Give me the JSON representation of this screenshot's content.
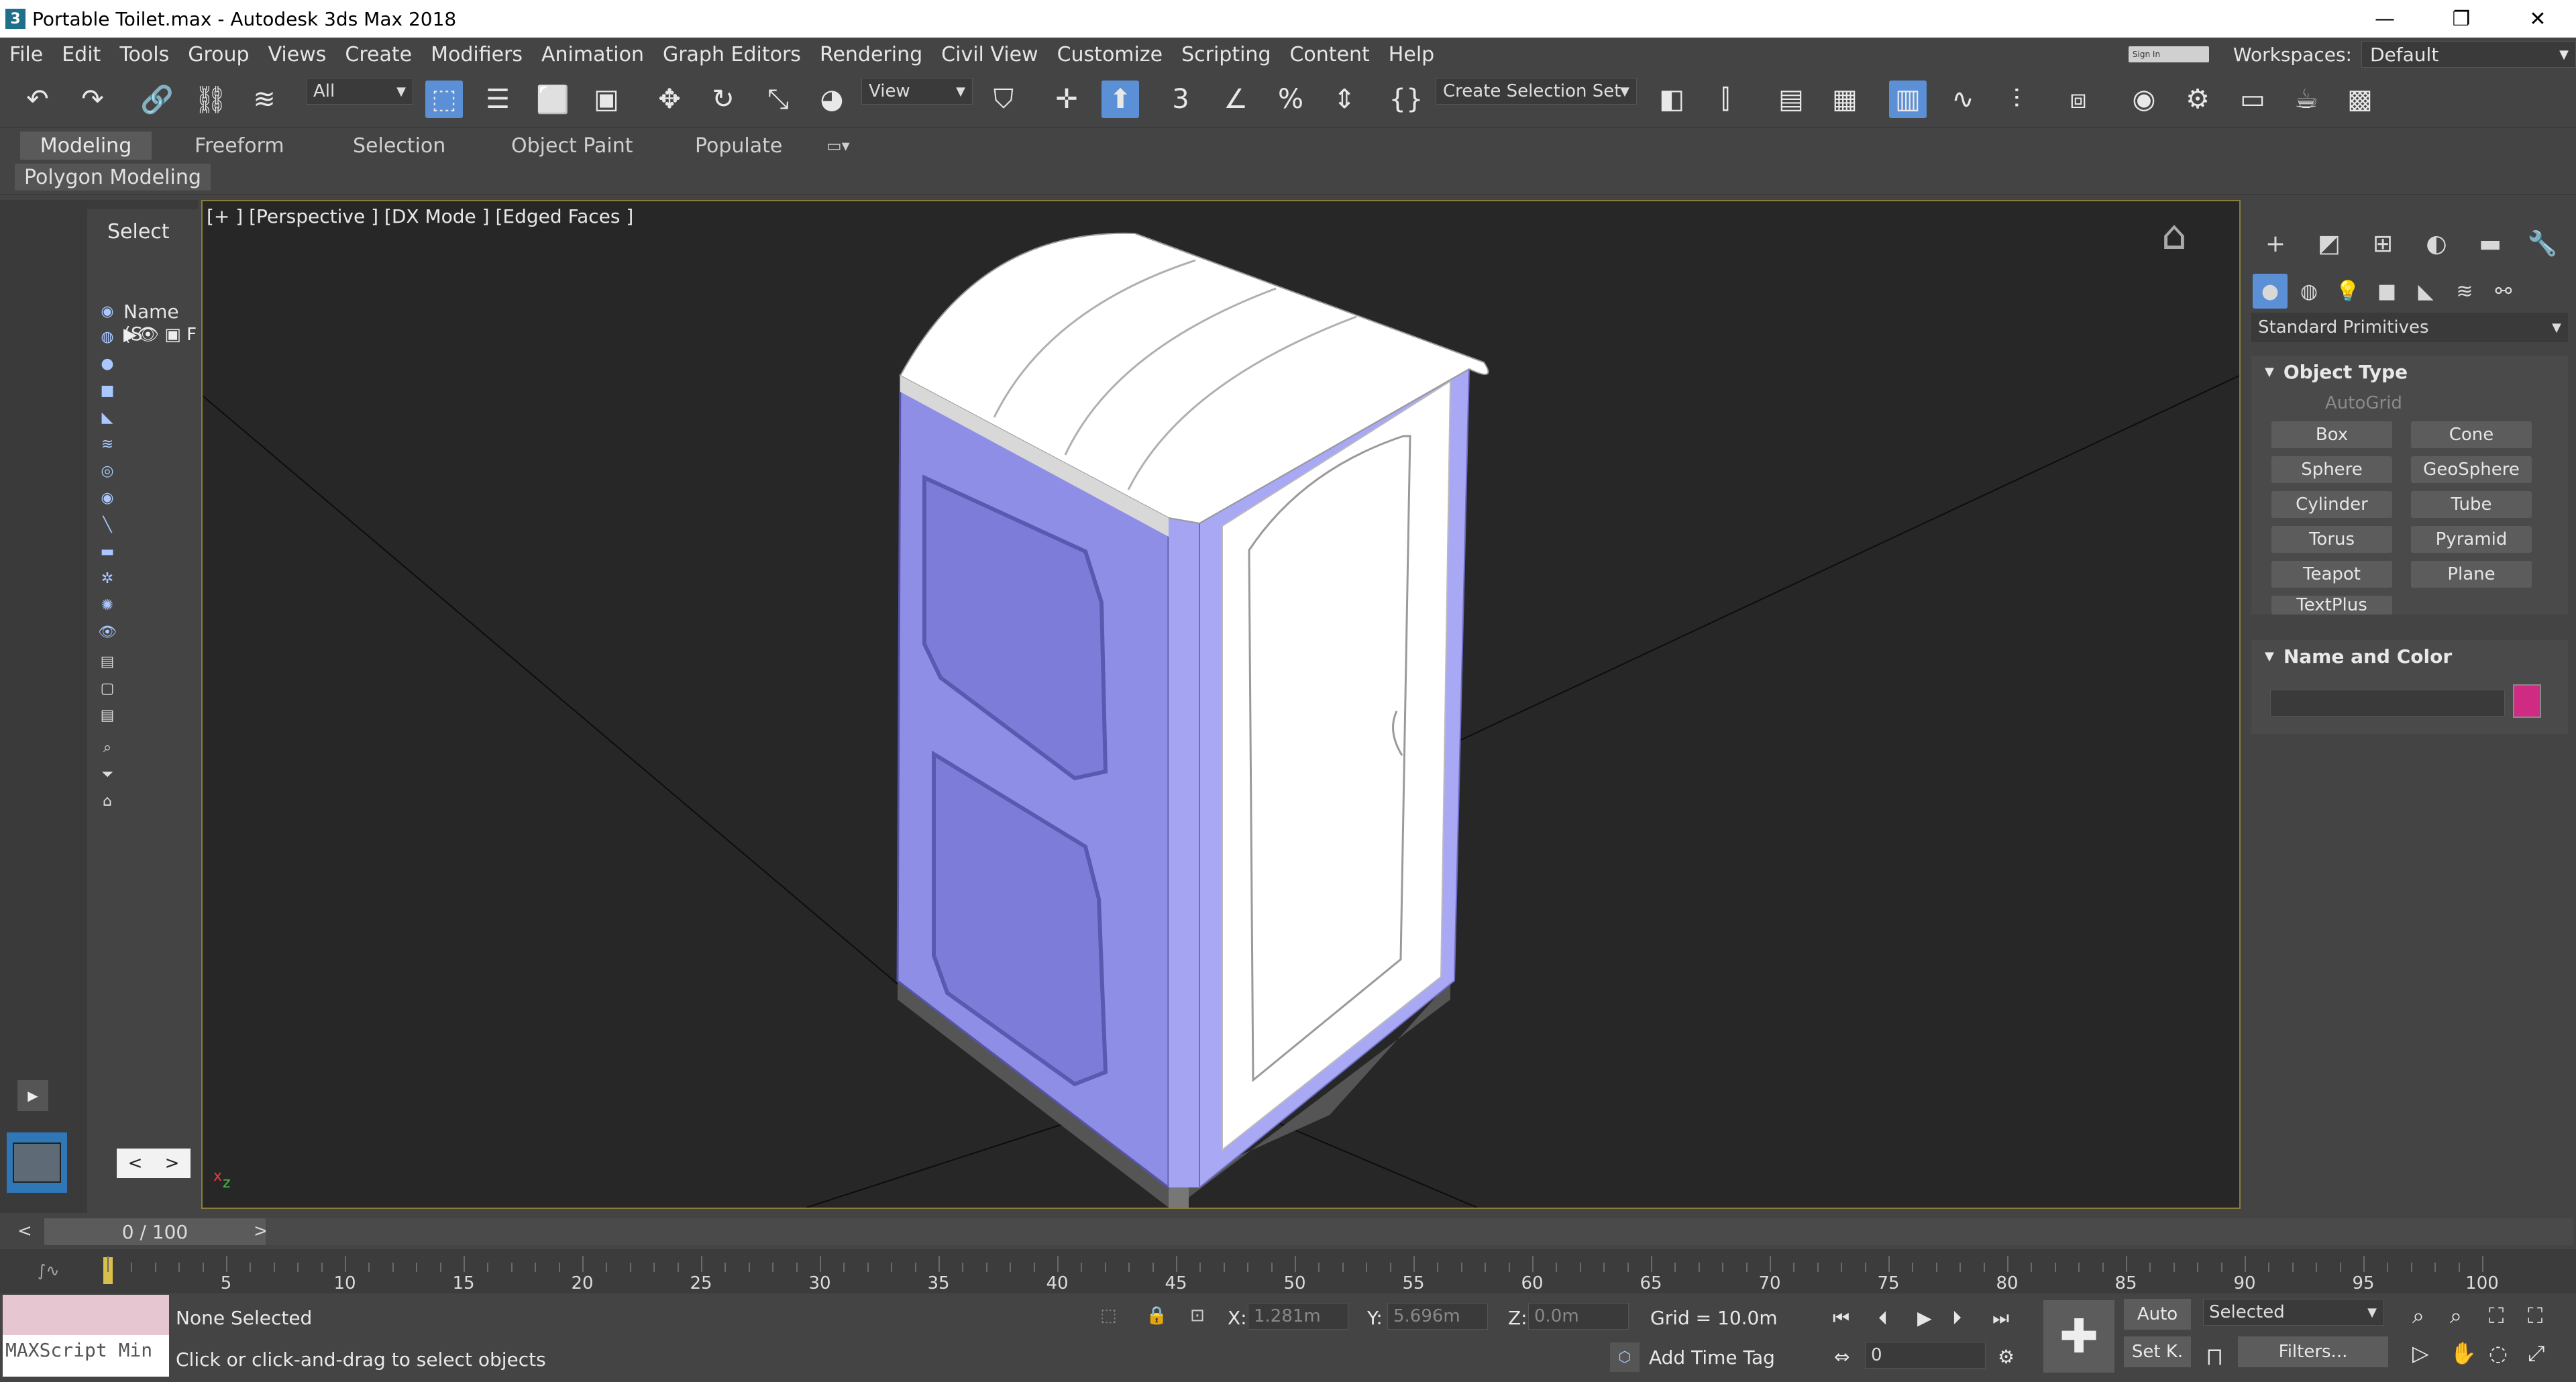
{
  "window": {
    "title": "Portable Toilet.max - Autodesk 3ds Max 2018",
    "app_icon": "3",
    "minimize": "—",
    "restore": "❐",
    "close": "✕"
  },
  "menu": [
    "File",
    "Edit",
    "Tools",
    "Group",
    "Views",
    "Create",
    "Modifiers",
    "Animation",
    "Graph Editors",
    "Rendering",
    "Civil View",
    "Customize",
    "Scripting",
    "Content",
    "Help"
  ],
  "signin": "Sign In",
  "workspace": {
    "label": "Workspaces:",
    "value": "Default"
  },
  "toolbar": {
    "selection_filter": "All",
    "ref_coord": "View",
    "selection_set": "Create Selection Set",
    "icons": [
      "undo-icon",
      "redo-icon",
      "link-icon",
      "unlink-icon",
      "bind-spacewarp-icon",
      "select-object-icon",
      "select-by-name-icon",
      "rect-region-icon",
      "window-crossing-icon",
      "move-icon",
      "rotate-icon",
      "scale-icon",
      "placement-icon",
      "pivot-icon",
      "snap-toggle-icon",
      "angle-snap-icon",
      "percent-snap-icon",
      "spinner-snap-icon",
      "edit-named-sets-icon",
      "mirror-icon",
      "align-icon",
      "layer-explorer-icon",
      "toggle-ribbon-icon",
      "scene-explorer-icon",
      "curve-editor-icon",
      "dope-sheet-icon",
      "schematic-view-icon",
      "material-editor-icon",
      "render-setup-icon",
      "rendered-frame-icon",
      "render-icon",
      "render-online-icon"
    ]
  },
  "ribbon": {
    "tabs": [
      "Modeling",
      "Freeform",
      "Selection",
      "Object Paint",
      "Populate"
    ],
    "sub_tab": "Polygon Modeling"
  },
  "scene_explorer": {
    "select_label": "Select",
    "name_header": "Name (S",
    "row_label": "F"
  },
  "viewport": {
    "label": "[+ ] [Perspective ] [DX Mode ] [Edged Faces ]"
  },
  "command_panel": {
    "category": "Standard Primitives",
    "object_type": {
      "title": "Object Type",
      "autogrid": "AutoGrid",
      "buttons": [
        "Box",
        "Cone",
        "Sphere",
        "GeoSphere",
        "Cylinder",
        "Tube",
        "Torus",
        "Pyramid",
        "Teapot",
        "Plane",
        "TextPlus"
      ]
    },
    "name_color": {
      "title": "Name and Color",
      "color": "#d02b82"
    }
  },
  "time_slider": {
    "value": "0 / 100",
    "prev": "<",
    "next": ">"
  },
  "trackbar": {
    "ticks": [
      "5",
      "10",
      "15",
      "20",
      "25",
      "30",
      "35",
      "40",
      "45",
      "50",
      "55",
      "60",
      "65",
      "70",
      "75",
      "80",
      "85",
      "90",
      "95",
      "100"
    ]
  },
  "status": {
    "maxscript": "MAXScript Min",
    "selection": "None Selected",
    "prompt": "Click or click-and-drag to select objects",
    "x_label": "X:",
    "x_value": "1.281m",
    "y_label": "Y:",
    "y_value": "5.696m",
    "z_label": "Z:",
    "z_value": "0.0m",
    "grid": "Grid = 10.0m",
    "add_time_tag": "Add Time Tag",
    "frame": "0",
    "auto_key": "Auto",
    "set_key": "Set K.",
    "key_filter": "Selected",
    "filters": "Filters..."
  }
}
